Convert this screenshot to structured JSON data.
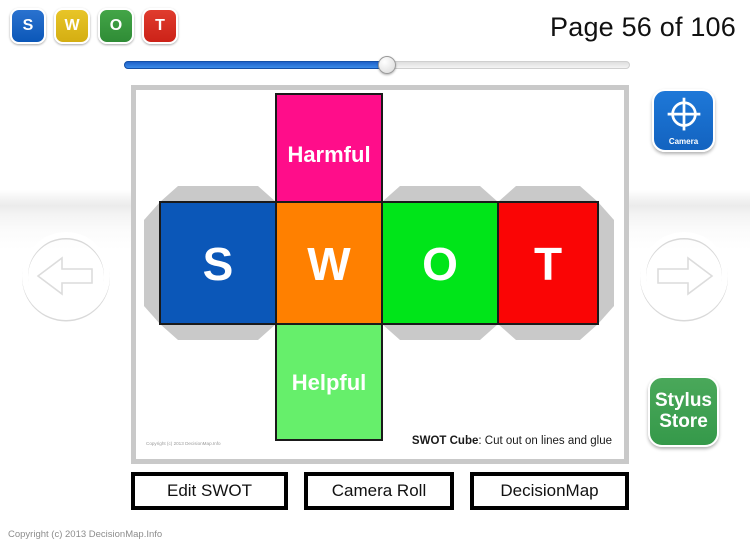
{
  "app": {
    "page_indicator": "Page 56 of 106",
    "footer_copyright": "Copyright (c) 2013 DecisionMap.Info"
  },
  "badges": [
    {
      "letter": "S",
      "name": "strengths",
      "color": "#0b57b8"
    },
    {
      "letter": "W",
      "name": "weaknesses",
      "color": "#d4ae12"
    },
    {
      "letter": "O",
      "name": "opportunities",
      "color": "#2f8c36"
    },
    {
      "letter": "T",
      "name": "threats",
      "color": "#cc2218"
    }
  ],
  "slider": {
    "value_percent": 52,
    "fill_color": "#1f62c9",
    "track_color": "#e8e8e8"
  },
  "nav": {
    "prev_icon": "arrow-left-circle-icon",
    "next_icon": "arrow-right-circle-icon"
  },
  "side_buttons": {
    "camera": {
      "label": "Camera",
      "icon": "crosshair-target-icon",
      "color": "#1363c0"
    },
    "stylus": {
      "line1": "Stylus",
      "line2": "Store",
      "color": "#35994a"
    }
  },
  "cube": {
    "caption_bold": "SWOT Cube",
    "caption_rest": ": Cut out on lines and glue",
    "inner_copyright": "Copyright (c) 2013 DecisionMap.Info",
    "faces": [
      {
        "id": "harmful",
        "label": "Harmful",
        "color": "#ff0d8a",
        "text_color": "#ffffff",
        "font_size": 22
      },
      {
        "id": "strengths",
        "label": "S",
        "color": "#0b57b8",
        "text_color": "#ffffff",
        "font_size": 46
      },
      {
        "id": "weaknesses",
        "label": "W",
        "color": "#ff8000",
        "text_color": "#ffffff",
        "font_size": 46
      },
      {
        "id": "opportunities",
        "label": "O",
        "color": "#00e519",
        "text_color": "#ffffff",
        "font_size": 46
      },
      {
        "id": "threats",
        "label": "T",
        "color": "#fa0505",
        "text_color": "#ffffff",
        "font_size": 46
      },
      {
        "id": "helpful",
        "label": "Helpful",
        "color": "#66ef6b",
        "text_color": "#ffffff",
        "font_size": 22
      }
    ],
    "tab_color": "#c9c9c9",
    "outline_color": "#1a1a1a"
  },
  "bottom_buttons": [
    {
      "id": "edit-swot",
      "label": "Edit SWOT"
    },
    {
      "id": "camera-roll",
      "label": "Camera Roll"
    },
    {
      "id": "decisionmap",
      "label": "DecisionMap"
    }
  ]
}
